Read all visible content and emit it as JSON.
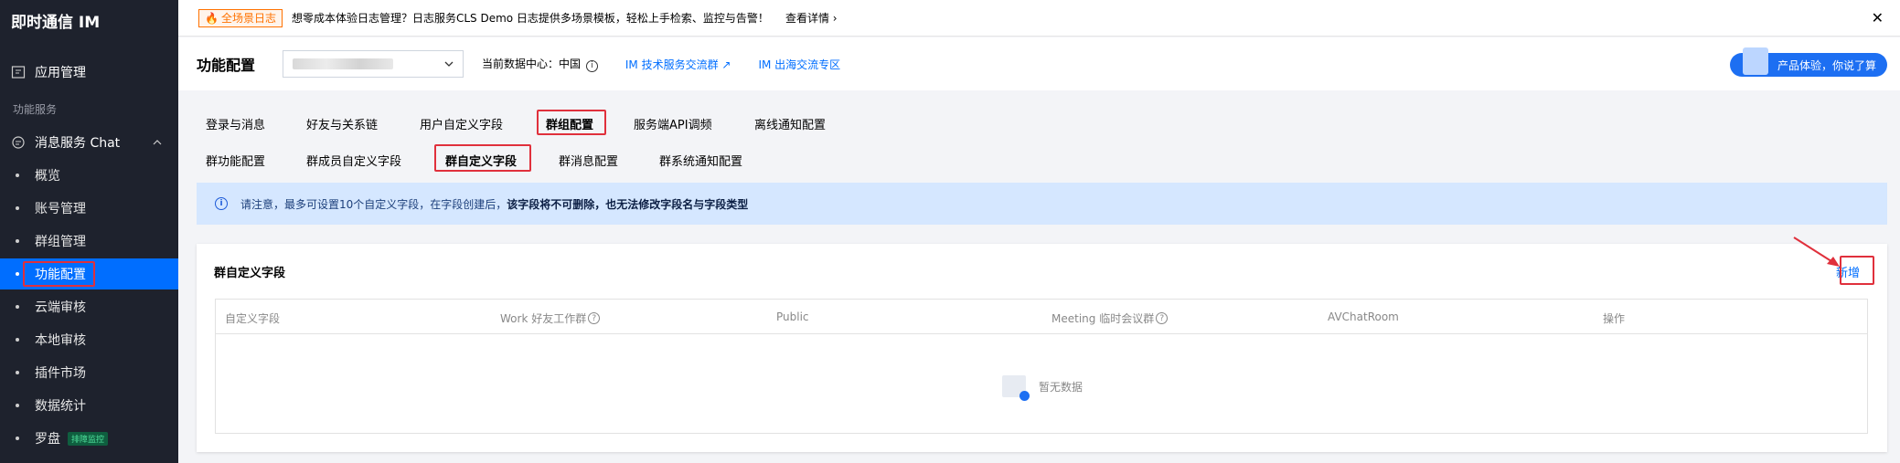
{
  "app": {
    "logo": "即时通信 IM"
  },
  "sidebar": {
    "app_manage": "应用管理",
    "group_label": "功能服务",
    "chat_label": "消息服务 Chat",
    "items": [
      {
        "label": "概览"
      },
      {
        "label": "账号管理"
      },
      {
        "label": "群组管理"
      },
      {
        "label": "功能配置"
      },
      {
        "label": "云端审核"
      },
      {
        "label": "本地审核"
      },
      {
        "label": "插件市场"
      },
      {
        "label": "数据统计"
      },
      {
        "label": "罗盘",
        "badge": "排障监控"
      }
    ]
  },
  "notice": {
    "tag": "全场景日志",
    "text": "想零成本体验日志管理？日志服务CLS Demo 日志提供多场景模板，轻松上手检索、监控与告警！",
    "more": "查看详情",
    "close": "✕"
  },
  "header": {
    "title": "功能配置",
    "data_center": "当前数据中心：中国",
    "link1": "IM 技术服务交流群",
    "link2": "IM 出海交流专区",
    "promo": "产品体验，你说了算"
  },
  "tabs_primary": [
    "登录与消息",
    "好友与关系链",
    "用户自定义字段",
    "群组配置",
    "服务端API调频",
    "离线通知配置"
  ],
  "tabs_secondary": [
    "群功能配置",
    "群成员自定义字段",
    "群自定义字段",
    "群消息配置",
    "群系统通知配置"
  ],
  "info": {
    "prefix": "请注意，最多可设置10个自定义字段，在字段创建后，",
    "bold": "该字段将不可删除，也无法修改字段名与字段类型"
  },
  "card": {
    "title": "群自定义字段",
    "add": "新增",
    "columns": [
      "自定义字段",
      "Work 好友工作群",
      "Public",
      "Meeting 临时会议群",
      "AVChatRoom",
      "操作"
    ],
    "empty": "暂无数据"
  },
  "colors": {
    "accent": "#006eff",
    "highlight": "#e0303c",
    "sidebar_bg": "#1e222d"
  }
}
